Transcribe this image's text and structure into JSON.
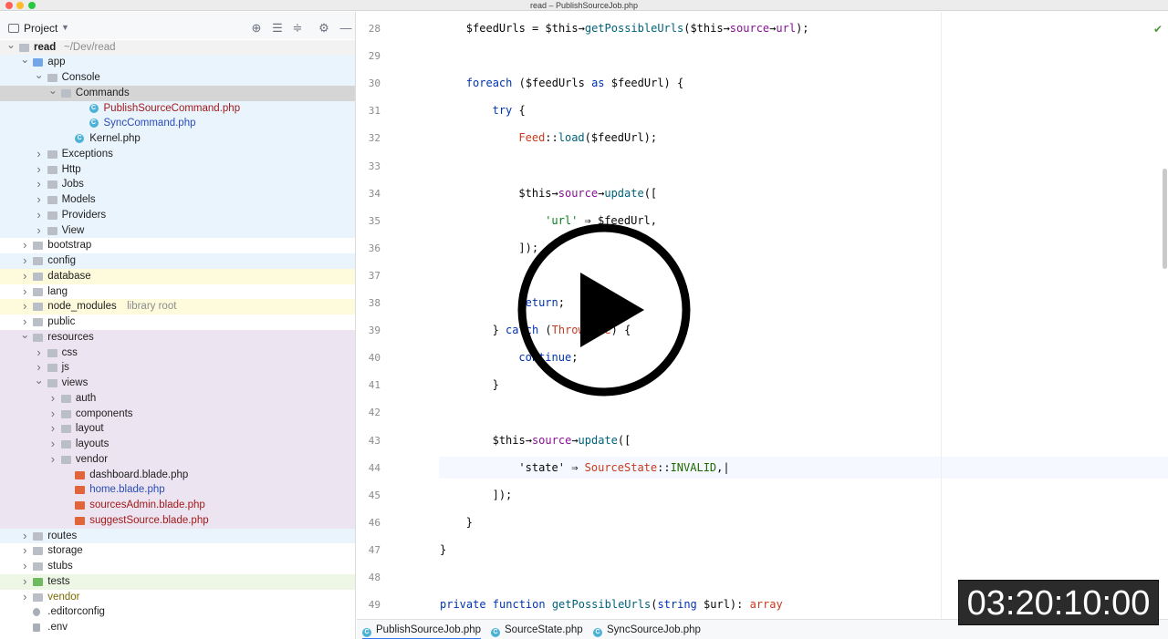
{
  "window": {
    "title": "read – PublishSourceJob.php"
  },
  "panel": {
    "title": "Project",
    "dropdown_icon": "chevron-down-icon"
  },
  "tree": [
    {
      "label": "read",
      "hint": "~/Dev/read",
      "depth": 0,
      "open": true,
      "kind": "folder",
      "bg": "#f2f2f2",
      "bold": true
    },
    {
      "label": "app",
      "depth": 1,
      "open": true,
      "kind": "folder-blue",
      "bg": "#eaf4fd"
    },
    {
      "label": "Console",
      "depth": 2,
      "open": true,
      "kind": "folder",
      "bg": "#eaf4fd"
    },
    {
      "label": "Commands",
      "depth": 3,
      "open": true,
      "kind": "folder",
      "bg": "#d5d5d5"
    },
    {
      "label": "PublishSourceCommand.php",
      "depth": 5,
      "kind": "class",
      "bg": "#eaf4fd",
      "color": "red"
    },
    {
      "label": "SyncCommand.php",
      "depth": 5,
      "kind": "class",
      "bg": "#eaf4fd",
      "color": "blue"
    },
    {
      "label": "Kernel.php",
      "depth": 4,
      "kind": "class",
      "bg": "#eaf4fd"
    },
    {
      "label": "Exceptions",
      "depth": 2,
      "open": false,
      "kind": "folder",
      "bg": "#eaf4fd"
    },
    {
      "label": "Http",
      "depth": 2,
      "open": false,
      "kind": "folder",
      "bg": "#eaf4fd"
    },
    {
      "label": "Jobs",
      "depth": 2,
      "open": false,
      "kind": "folder",
      "bg": "#eaf4fd"
    },
    {
      "label": "Models",
      "depth": 2,
      "open": false,
      "kind": "folder",
      "bg": "#eaf4fd"
    },
    {
      "label": "Providers",
      "depth": 2,
      "open": false,
      "kind": "folder",
      "bg": "#eaf4fd"
    },
    {
      "label": "View",
      "depth": 2,
      "open": false,
      "kind": "folder",
      "bg": "#eaf4fd"
    },
    {
      "label": "bootstrap",
      "depth": 1,
      "open": false,
      "kind": "folder",
      "bg": "#ffffff"
    },
    {
      "label": "config",
      "depth": 1,
      "open": false,
      "kind": "folder",
      "bg": "#eaf4fd"
    },
    {
      "label": "database",
      "depth": 1,
      "open": false,
      "kind": "folder",
      "bg": "#fdfbdc"
    },
    {
      "label": "lang",
      "depth": 1,
      "open": false,
      "kind": "folder",
      "bg": "#ffffff"
    },
    {
      "label": "node_modules",
      "hint": "library root",
      "depth": 1,
      "open": false,
      "kind": "folder",
      "bg": "#fdfbdc"
    },
    {
      "label": "public",
      "depth": 1,
      "open": false,
      "kind": "folder",
      "bg": "#ffffff"
    },
    {
      "label": "resources",
      "depth": 1,
      "open": true,
      "kind": "folder",
      "bg": "#ece4f0"
    },
    {
      "label": "css",
      "depth": 2,
      "open": false,
      "kind": "folder",
      "bg": "#ece4f0"
    },
    {
      "label": "js",
      "depth": 2,
      "open": false,
      "kind": "folder",
      "bg": "#ece4f0"
    },
    {
      "label": "views",
      "depth": 2,
      "open": true,
      "kind": "folder",
      "bg": "#ece4f0"
    },
    {
      "label": "auth",
      "depth": 3,
      "open": false,
      "kind": "folder",
      "bg": "#ece4f0"
    },
    {
      "label": "components",
      "depth": 3,
      "open": false,
      "kind": "folder",
      "bg": "#ece4f0"
    },
    {
      "label": "layout",
      "depth": 3,
      "open": false,
      "kind": "folder",
      "bg": "#ece4f0"
    },
    {
      "label": "layouts",
      "depth": 3,
      "open": false,
      "kind": "folder",
      "bg": "#ece4f0"
    },
    {
      "label": "vendor",
      "depth": 3,
      "open": false,
      "kind": "folder",
      "bg": "#ece4f0"
    },
    {
      "label": "dashboard.blade.php",
      "depth": 4,
      "kind": "blade",
      "bg": "#ece4f0"
    },
    {
      "label": "home.blade.php",
      "depth": 4,
      "kind": "blade",
      "bg": "#ece4f0",
      "color": "blue"
    },
    {
      "label": "sourcesAdmin.blade.php",
      "depth": 4,
      "kind": "blade",
      "bg": "#ece4f0",
      "color": "red"
    },
    {
      "label": "suggestSource.blade.php",
      "depth": 4,
      "kind": "blade",
      "bg": "#ece4f0",
      "color": "red"
    },
    {
      "label": "routes",
      "depth": 1,
      "open": false,
      "kind": "folder",
      "bg": "#eaf4fd"
    },
    {
      "label": "storage",
      "depth": 1,
      "open": false,
      "kind": "folder",
      "bg": "#ffffff"
    },
    {
      "label": "stubs",
      "depth": 1,
      "open": false,
      "kind": "folder",
      "bg": "#ffffff"
    },
    {
      "label": "tests",
      "depth": 1,
      "open": false,
      "kind": "folder-green",
      "bg": "#eef6e6"
    },
    {
      "label": "vendor",
      "depth": 1,
      "open": false,
      "kind": "folder",
      "bg": "#ffffff",
      "color": "olive"
    },
    {
      "label": ".editorconfig",
      "depth": 1,
      "kind": "gear-file",
      "bg": "#ffffff"
    },
    {
      "label": ".env",
      "depth": 1,
      "kind": "file",
      "bg": "#ffffff"
    }
  ],
  "code": [
    {
      "n": "28",
      "indent": 1,
      "parts": [
        [
          "var",
          "$feedUrls = $this→"
        ],
        [
          "fn",
          "getPossibleUrls"
        ],
        [
          "var",
          "($this→"
        ],
        [
          "cl",
          "source"
        ],
        [
          "var",
          "→"
        ],
        [
          "cl",
          "url"
        ],
        [
          "var",
          ");"
        ]
      ]
    },
    {
      "n": "29",
      "indent": 0,
      "parts": []
    },
    {
      "n": "30",
      "indent": 1,
      "parts": [
        [
          "kw",
          "foreach"
        ],
        [
          "var",
          " ($feedUrls "
        ],
        [
          "kw",
          "as"
        ],
        [
          "var",
          " $feedUrl) {"
        ]
      ]
    },
    {
      "n": "31",
      "indent": 2,
      "parts": [
        [
          "kw",
          "try"
        ],
        [
          "var",
          " {"
        ]
      ]
    },
    {
      "n": "32",
      "indent": 3,
      "parts": [
        [
          "ty",
          "Feed"
        ],
        [
          "var",
          "::"
        ],
        [
          "fn",
          "load"
        ],
        [
          "var",
          "($feedUrl);"
        ]
      ]
    },
    {
      "n": "33",
      "indent": 0,
      "parts": []
    },
    {
      "n": "34",
      "indent": 3,
      "parts": [
        [
          "var",
          "$this→"
        ],
        [
          "cl",
          "source"
        ],
        [
          "var",
          "→"
        ],
        [
          "fn",
          "update"
        ],
        [
          "var",
          "(["
        ]
      ]
    },
    {
      "n": "35",
      "indent": 4,
      "parts": [
        [
          "str",
          "'url'"
        ],
        [
          "var",
          " ⇒ $feedUrl,"
        ]
      ]
    },
    {
      "n": "36",
      "indent": 3,
      "parts": [
        [
          "var",
          "]);"
        ]
      ]
    },
    {
      "n": "37",
      "indent": 0,
      "parts": []
    },
    {
      "n": "38",
      "indent": 3,
      "parts": [
        [
          "kw",
          "return"
        ],
        [
          "var",
          ";"
        ]
      ]
    },
    {
      "n": "39",
      "indent": 2,
      "parts": [
        [
          "var",
          "} "
        ],
        [
          "kw",
          "catch"
        ],
        [
          "var",
          " ("
        ],
        [
          "ty",
          "Throwable"
        ],
        [
          "var",
          ") {"
        ]
      ]
    },
    {
      "n": "40",
      "indent": 3,
      "parts": [
        [
          "kw",
          "continue"
        ],
        [
          "var",
          ";"
        ]
      ]
    },
    {
      "n": "41",
      "indent": 2,
      "parts": [
        [
          "var",
          "}"
        ]
      ]
    },
    {
      "n": "42",
      "indent": 0,
      "parts": []
    },
    {
      "n": "43",
      "indent": 2,
      "parts": [
        [
          "var",
          "$this→"
        ],
        [
          "cl",
          "source"
        ],
        [
          "var",
          "→"
        ],
        [
          "fn",
          "update"
        ],
        [
          "var",
          "(["
        ]
      ]
    },
    {
      "n": "44",
      "indent": 3,
      "parts": [
        [
          "var",
          "'state' ⇒ "
        ],
        [
          "ty",
          "SourceState"
        ],
        [
          "var",
          "::"
        ],
        [
          "cst",
          "INVALID"
        ],
        [
          "var",
          ",|"
        ]
      ]
    },
    {
      "n": "45",
      "indent": 2,
      "parts": [
        [
          "var",
          "]);"
        ]
      ]
    },
    {
      "n": "46",
      "indent": 1,
      "parts": [
        [
          "var",
          "}"
        ]
      ]
    },
    {
      "n": "47",
      "indent": 0,
      "parts": [
        [
          "var",
          "}"
        ]
      ]
    },
    {
      "n": "48",
      "indent": 0,
      "parts": []
    },
    {
      "n": "49",
      "indent": 0,
      "parts": [
        [
          "kw",
          "private function "
        ],
        [
          "fn",
          "getPossibleUrls"
        ],
        [
          "var",
          "("
        ],
        [
          "kw",
          "string"
        ],
        [
          "var",
          " $url): "
        ],
        [
          "ty",
          "array"
        ]
      ]
    }
  ],
  "tabs": [
    {
      "label": "PublishSourceJob.php",
      "active": true
    },
    {
      "label": "SourceState.php",
      "active": false
    },
    {
      "label": "SyncSourceJob.php",
      "active": false
    }
  ],
  "overlay": {
    "timecode": "03:20:10:00"
  },
  "colors": {
    "accent": "#3574f0",
    "keyword": "#0033b3",
    "function": "#00627a",
    "string": "#067d17"
  }
}
